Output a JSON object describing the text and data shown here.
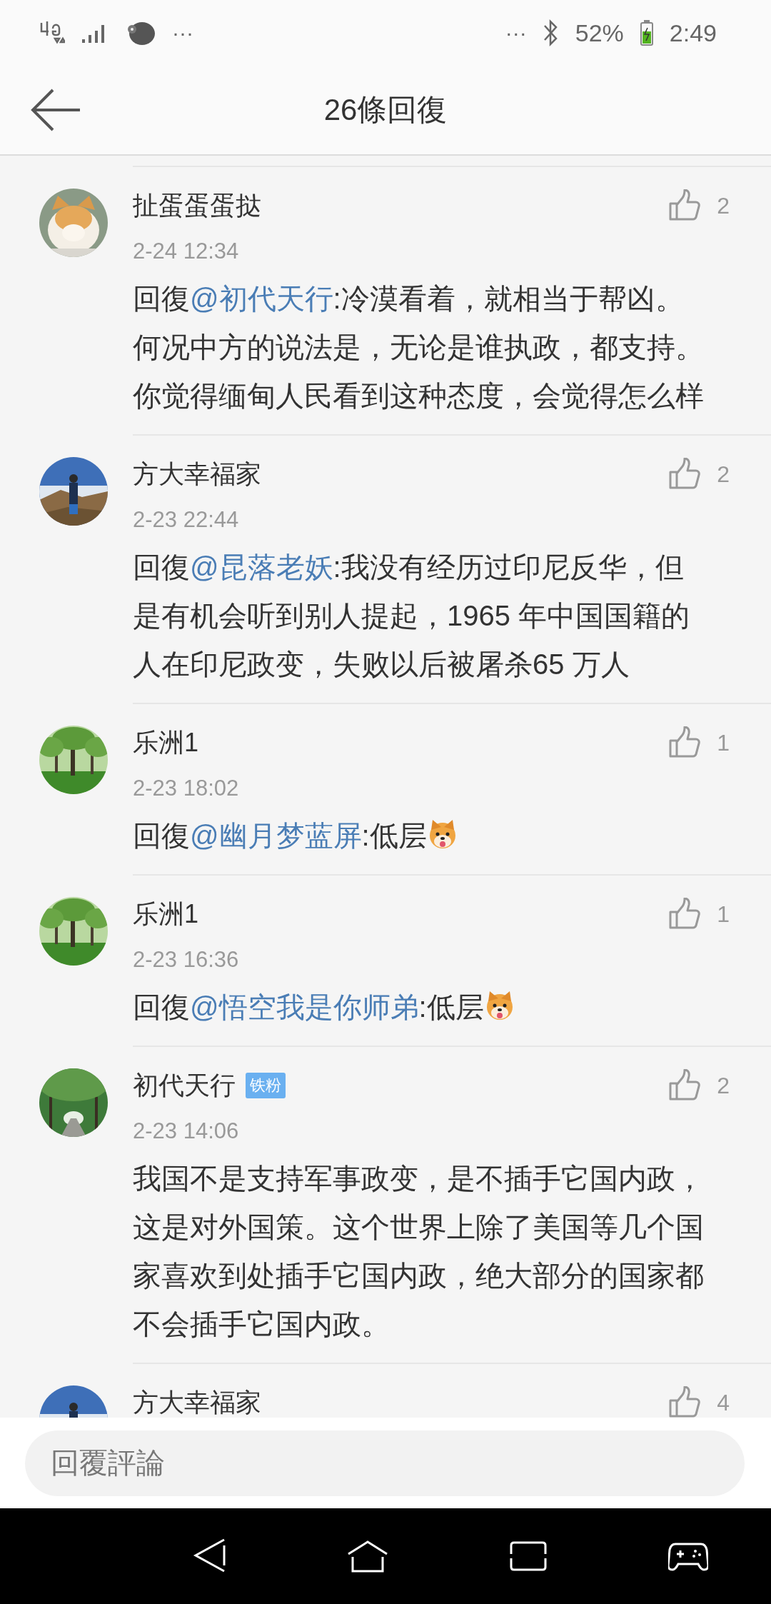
{
  "status_bar": {
    "left_more": "···",
    "right_more": "···",
    "battery_text": "52%",
    "time": "2:49"
  },
  "header": {
    "title": "26條回復"
  },
  "comments": [
    {
      "author": "扯蛋蛋蛋挞",
      "time": "2-24 12:34",
      "likes": "2",
      "body": {
        "prefix": "回復",
        "mention": "@初代天行",
        "text": ":冷漠看着，就相当于帮凶。何况中方的说法是，无论是谁执政，都支持。你觉得缅甸人民看到这种态度，会觉得怎么样"
      }
    },
    {
      "author": "方大幸福家",
      "time": "2-23 22:44",
      "likes": "2",
      "body": {
        "prefix": "回復",
        "mention": "@昆落老妖",
        "text": ":我没有经历过印尼反华，但是有机会听到别人提起，1965 年中国国籍的人在印尼政变，失败以后被屠杀65 万人"
      }
    },
    {
      "author": "乐洲1",
      "time": "2-23 18:02",
      "likes": "1",
      "body": {
        "prefix": "回復",
        "mention": "@幽月梦蓝屏",
        "text": ":低层"
      },
      "has_emoji": true
    },
    {
      "author": "乐洲1",
      "time": "2-23 16:36",
      "likes": "1",
      "body": {
        "prefix": "回復",
        "mention": "@悟空我是你师弟",
        "text": ":低层"
      },
      "has_emoji": true
    },
    {
      "author": "初代天行",
      "badge": "铁粉",
      "time": "2-23 14:06",
      "likes": "2",
      "body": {
        "text": "我国不是支持军事政变，是不插手它国内政，这是对外国策。这个世界上除了美国等几个国家喜欢到处插手它国内政，绝大部分的国家都不会插手它国内政。"
      }
    },
    {
      "author": "方大幸福家",
      "likes": "4"
    }
  ],
  "reply_bar": {
    "placeholder": "回覆評論"
  }
}
